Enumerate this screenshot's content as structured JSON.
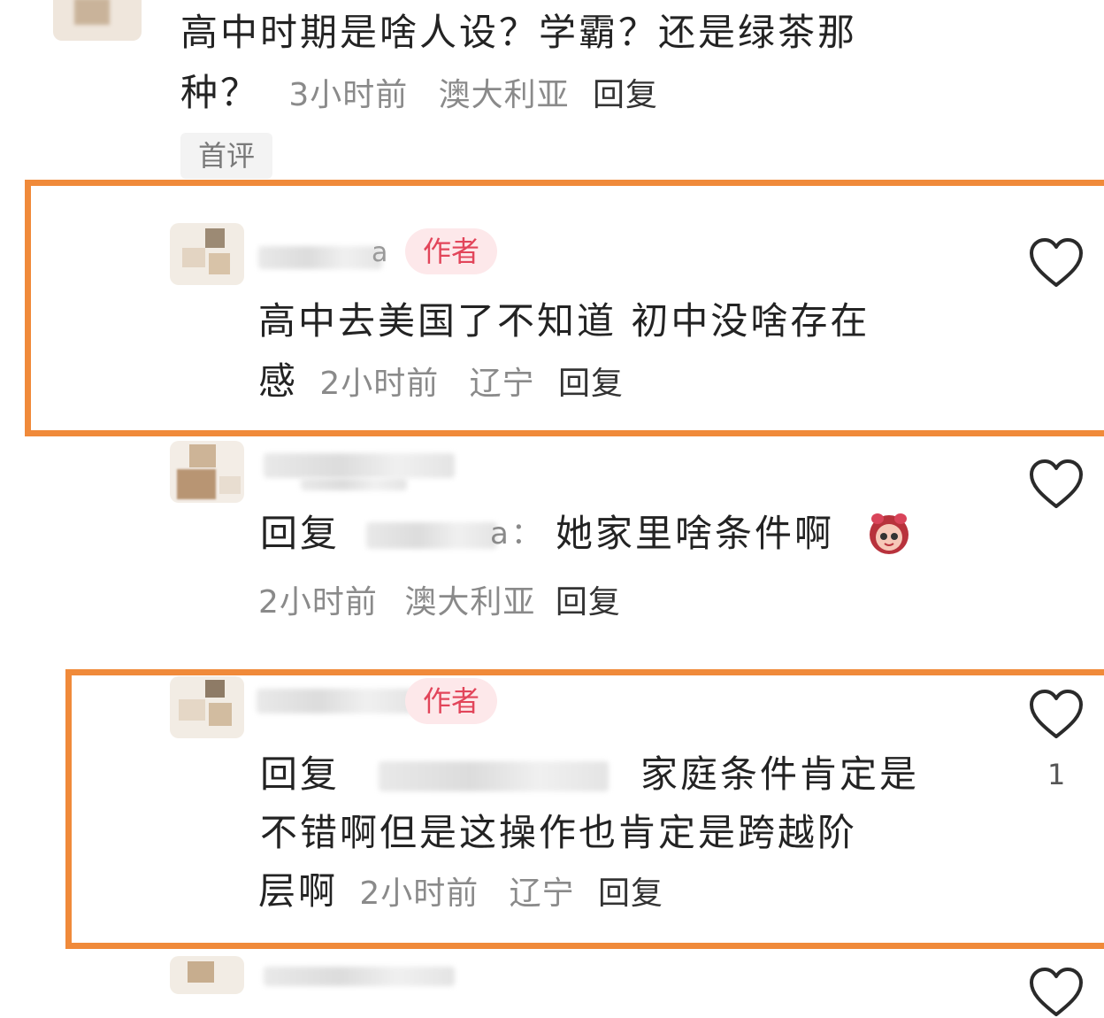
{
  "comment0": {
    "line1": "高中时期是啥人设？学霸？还是绿茶那",
    "line2_text": "种？",
    "time": "3小时前",
    "location": "澳大利亚",
    "reply": "回复",
    "first_tag": "首评"
  },
  "comment1": {
    "name_partial": "a",
    "badge": "作者",
    "line1": "高中去美国了不知道 初中没啥存在",
    "line2_text": "感",
    "time": "2小时前",
    "location": "辽宁",
    "reply": "回复",
    "liked_icon": "heart-outline-icon"
  },
  "comment2": {
    "prefix": "回复",
    "target_partial": "a：",
    "text": "她家里啥条件啊",
    "emoji": "girl-face-emoji",
    "time": "2小时前",
    "location": "澳大利亚",
    "reply": "回复"
  },
  "comment3": {
    "badge": "作者",
    "prefix": "回复",
    "line1_text": "家庭条件肯定是",
    "line2": "不错啊但是这操作也肯定是跨越阶",
    "line3_text": "层啊",
    "time": "2小时前",
    "location": "辽宁",
    "reply": "回复",
    "like_count": "1"
  },
  "colors": {
    "highlight": "#f08a3a",
    "author_badge_bg": "#fde8ea",
    "author_badge_text": "#e2455a",
    "meta": "#8a8a8a"
  }
}
